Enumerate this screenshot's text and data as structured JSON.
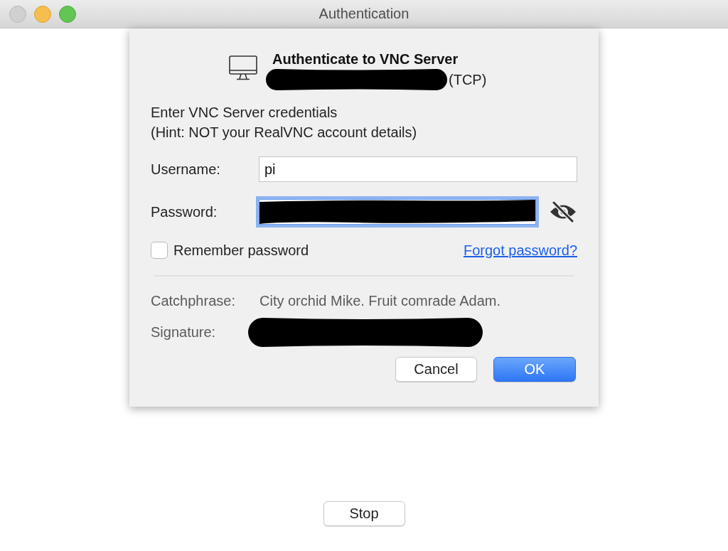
{
  "window": {
    "title": "Authentication",
    "controls": [
      {
        "kind": "close",
        "disabled": true
      },
      {
        "kind": "minimize",
        "disabled": false
      },
      {
        "kind": "zoom",
        "disabled": false
      }
    ]
  },
  "dialog": {
    "heading": "Authenticate to VNC Server",
    "server": {
      "redacted": true,
      "suffix": "(TCP)"
    },
    "instructions": [
      "Enter VNC Server credentials",
      "(Hint: NOT your RealVNC account details)"
    ],
    "fields": [
      {
        "kind": "text",
        "label": "Username:",
        "value": "pi",
        "focused": false
      },
      {
        "kind": "password",
        "label": "Password:",
        "focused": true,
        "redacted": true
      }
    ],
    "remember": {
      "label": "Remember password",
      "checked": false
    },
    "forgot_link": "Forgot password?",
    "info": [
      {
        "label": "Catchphrase:",
        "value": "City orchid Mike. Fruit comrade Adam."
      },
      {
        "label": "Signature:",
        "redacted": true
      }
    ],
    "buttons": [
      {
        "label": "Cancel",
        "default": false
      },
      {
        "label": "OK",
        "default": true
      }
    ]
  },
  "stop_button": "Stop"
}
